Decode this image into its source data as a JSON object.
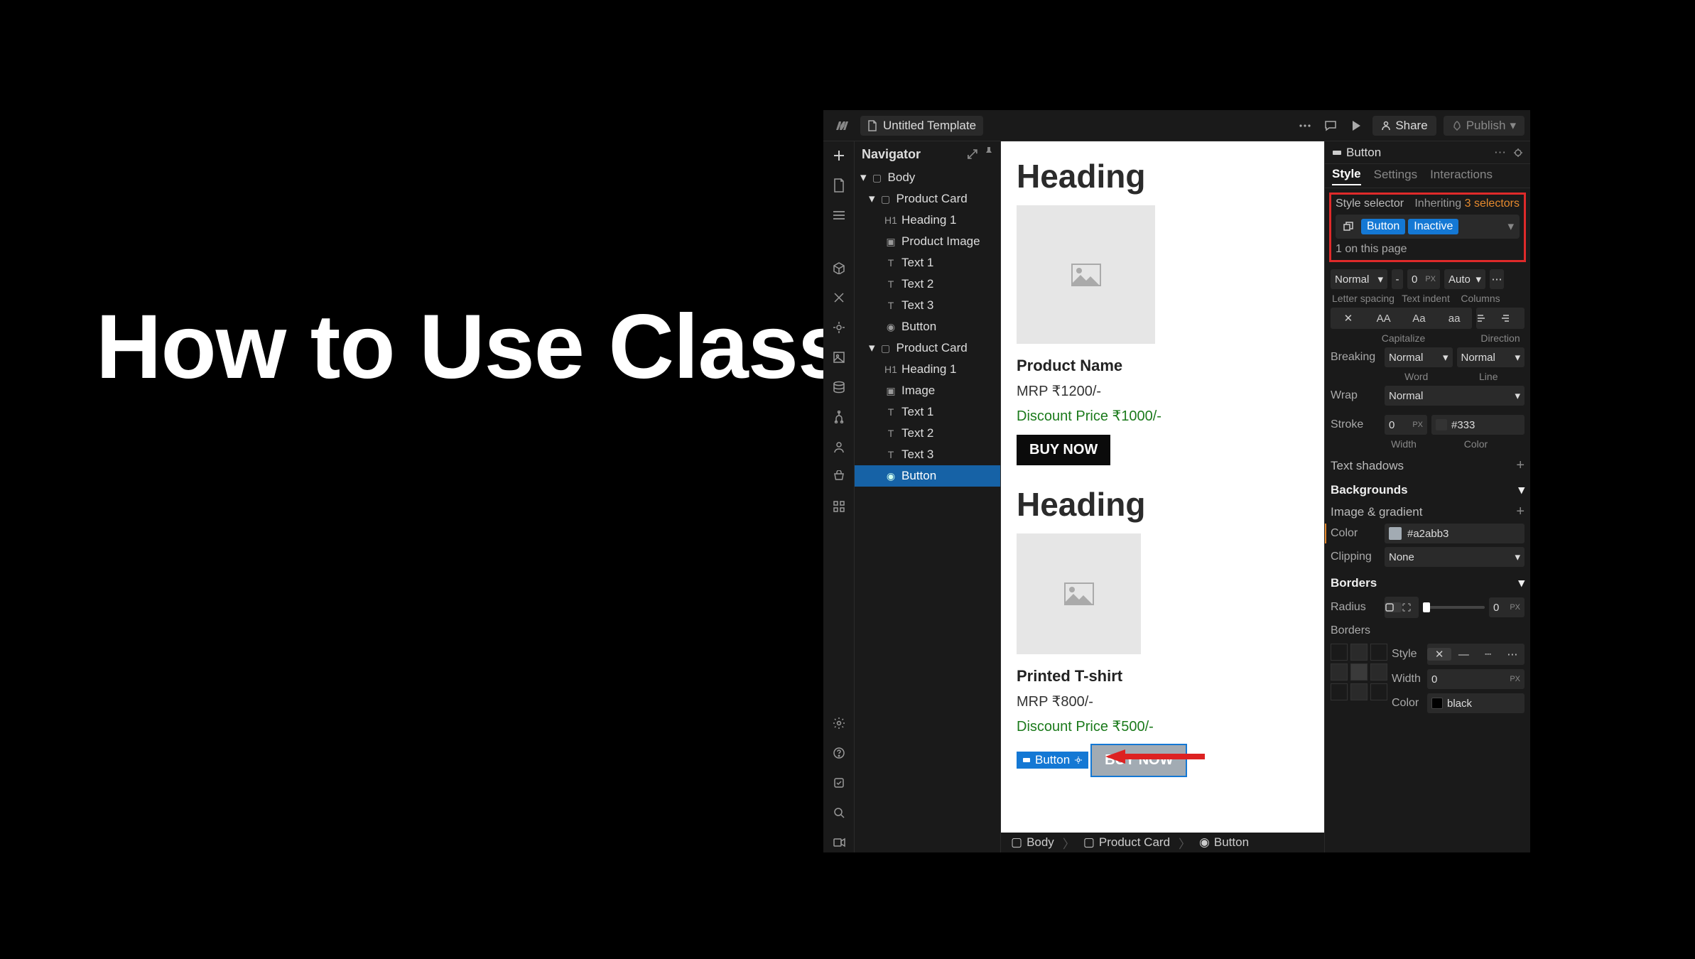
{
  "hero": {
    "title": "How to Use Classes in Webflow"
  },
  "topbar": {
    "page_title": "Untitled Template",
    "share": "Share",
    "publish": "Publish"
  },
  "navigator": {
    "title": "Navigator",
    "tree": {
      "body": "Body",
      "card1": {
        "label": "Product Card",
        "heading": "Heading 1",
        "image": "Product Image",
        "t1": "Text 1",
        "t2": "Text 2",
        "t3": "Text 3",
        "button": "Button"
      },
      "card2": {
        "label": "Product Card",
        "heading": "Heading 1",
        "image": "Image",
        "t1": "Text 1",
        "t2": "Text 2",
        "t3": "Text 3",
        "button": "Button"
      }
    }
  },
  "canvas": {
    "card1": {
      "heading": "Heading",
      "name": "Product Name",
      "mrp": "MRP ₹1200/-",
      "discount": "Discount Price ₹1000/-",
      "buy": "BUY NOW"
    },
    "card2": {
      "heading": "Heading",
      "name": "Printed T-shirt",
      "mrp": "MRP ₹800/-",
      "discount": "Discount Price ₹500/-",
      "sel_label": "Button",
      "buy": "BUY NOW"
    }
  },
  "breadcrumb": {
    "body": "Body",
    "pc": "Product Card",
    "btn": "Button"
  },
  "style_panel": {
    "sel_element": "Button",
    "tabs": {
      "style": "Style",
      "settings": "Settings",
      "interactions": "Interactions"
    },
    "selector": {
      "label": "Style selector",
      "inheriting": "Inheriting ",
      "inheriting_count": "3 selectors",
      "tag1": "Button",
      "tag2": "Inactive",
      "on_page": "1 on this page"
    },
    "typo": {
      "normal": "Normal",
      "dash": "-",
      "zero": "0",
      "px": "PX",
      "auto": "Auto",
      "letter_spacing": "Letter spacing",
      "text_indent": "Text indent",
      "columns": "Columns",
      "aa_caps": "AA",
      "aa_title": "Aa",
      "aa_lower": "aa",
      "capitalize": "Capitalize",
      "direction": "Direction",
      "breaking": "Breaking",
      "breaking_v1": "Normal",
      "breaking_v2": "Normal",
      "word": "Word",
      "line": "Line",
      "wrap": "Wrap",
      "wrap_v": "Normal",
      "stroke": "Stroke",
      "stroke_w": "0",
      "stroke_px": "PX",
      "stroke_c": "#333",
      "width": "Width",
      "color": "Color",
      "text_shadows": "Text shadows"
    },
    "backgrounds": {
      "title": "Backgrounds",
      "image_gradient": "Image & gradient",
      "color_lab": "Color",
      "color_val": "#a2abb3",
      "clipping": "Clipping",
      "clipping_v": "None"
    },
    "borders": {
      "title": "Borders",
      "radius": "Radius",
      "radius_v": "0",
      "radius_px": "PX",
      "borders_lab": "Borders",
      "style": "Style",
      "width": "Width",
      "width_v": "0",
      "width_px": "PX",
      "color": "Color",
      "color_v": "black"
    }
  },
  "colors": {
    "bg_inactive": "#a2abb3",
    "highlight_red": "#df2a2a",
    "selected_blue": "#1478d4"
  }
}
